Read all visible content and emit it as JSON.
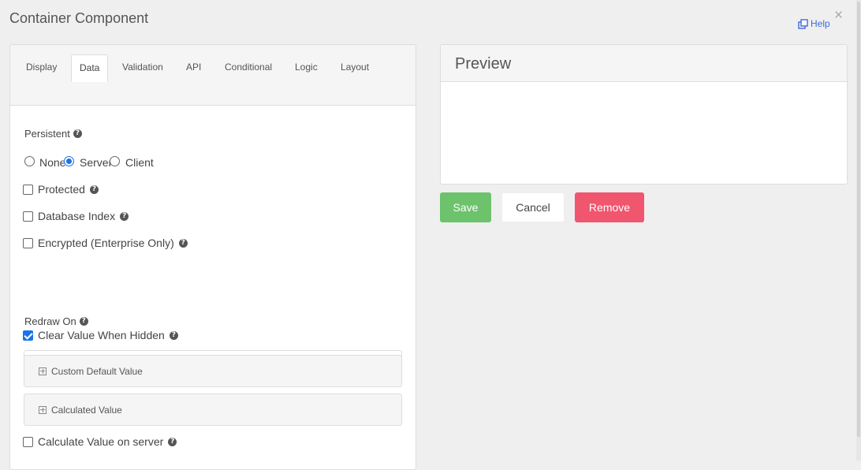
{
  "modal": {
    "title": "Container Component",
    "help_label": "Help",
    "close_symbol": "×"
  },
  "tabs": [
    {
      "label": "Display",
      "active": false
    },
    {
      "label": "Data",
      "active": true
    },
    {
      "label": "Validation",
      "active": false
    },
    {
      "label": "API",
      "active": false
    },
    {
      "label": "Conditional",
      "active": false
    },
    {
      "label": "Logic",
      "active": false
    },
    {
      "label": "Layout",
      "active": false
    }
  ],
  "form": {
    "persistent_label": "Persistent",
    "persistent_options": [
      {
        "label": "None",
        "checked": false
      },
      {
        "label": "Server",
        "checked": true
      },
      {
        "label": "Client",
        "checked": false
      }
    ],
    "protected_label": "Protected",
    "protected_checked": false,
    "db_index_label": "Database Index",
    "db_index_checked": false,
    "encrypted_label": "Encrypted (Enterprise Only)",
    "encrypted_checked": false,
    "redraw_label": "Redraw On",
    "redraw_value": "",
    "clear_hidden_label": "Clear Value When Hidden",
    "clear_hidden_checked": true,
    "custom_default_label": "Custom Default Value",
    "calculated_label": "Calculated Value",
    "calc_server_label": "Calculate Value on server",
    "calc_server_checked": false
  },
  "preview": {
    "title": "Preview"
  },
  "buttons": {
    "save": "Save",
    "cancel": "Cancel",
    "remove": "Remove"
  },
  "colors": {
    "save": "#6cc36c",
    "remove": "#f0566e",
    "link": "#3f6ad8",
    "checked": "#1a73e8"
  }
}
